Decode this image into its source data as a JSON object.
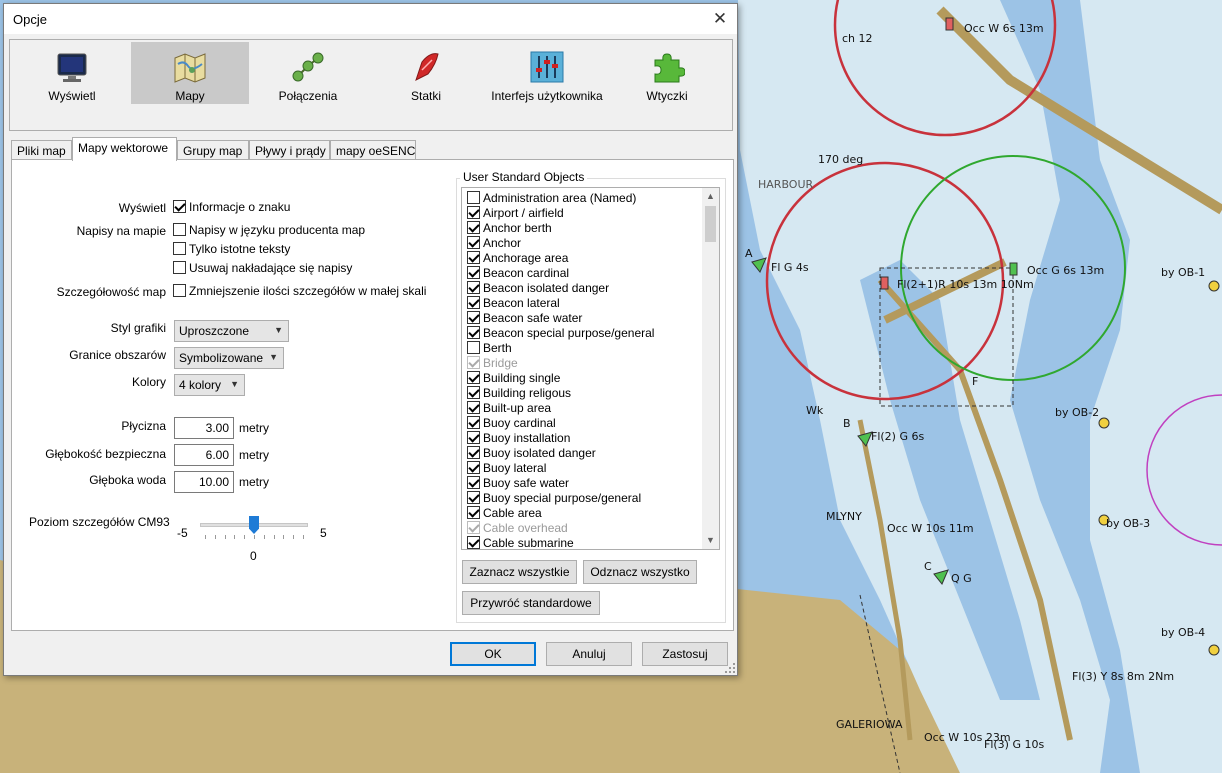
{
  "dialog": {
    "title": "Opcje",
    "close_glyph": "✕",
    "toolbar": [
      {
        "label": "Wyświetl",
        "icon": "monitor-icon"
      },
      {
        "label": "Mapy",
        "icon": "map-icon"
      },
      {
        "label": "Połączenia",
        "icon": "network-icon"
      },
      {
        "label": "Statki",
        "icon": "ship-icon"
      },
      {
        "label": "Interfejs użytkownika",
        "icon": "sliders-icon"
      },
      {
        "label": "Wtyczki",
        "icon": "puzzle-icon"
      }
    ],
    "active_toolbar": "Mapy",
    "tabs": [
      "Pliki map",
      "Mapy wektorowe",
      "Grupy map",
      "Pływy i prądy",
      "mapy oeSENC"
    ],
    "active_tab": "Mapy wektorowe",
    "left": {
      "display_label": "Wyświetl",
      "display_option": "Informacje o znaku",
      "text_label": "Napisy na mapie",
      "text_options": [
        "Napisy w języku producenta map",
        "Tylko istotne teksty",
        "Usuwaj nakładające się napisy"
      ],
      "detail_label": "Szczegółowość map",
      "detail_option": "Zmniejszenie ilości szczegółów w małej skali",
      "graphic_style_label": "Styl grafiki",
      "graphic_style_value": "Uproszczone",
      "boundaries_label": "Granice obszarów",
      "boundaries_value": "Symbolizowane",
      "colors_label": "Kolory",
      "colors_value": "4 kolory",
      "shallow_label": "Płycizna",
      "shallow_value": "3.00",
      "safety_label": "Głębokość bezpieczna",
      "safety_value": "6.00",
      "deep_label": "Głęboka woda",
      "deep_value": "10.00",
      "unit": "metry",
      "cm93_label": "Poziom szczegółów CM93",
      "cm93_min": "-5",
      "cm93_max": "5",
      "cm93_value": "0",
      "cm93_fraction": 0.5
    },
    "uso": {
      "title": "User Standard Objects",
      "items": [
        {
          "label": "Administration area (Named)",
          "checked": false,
          "disabled": false
        },
        {
          "label": "Airport / airfield",
          "checked": true,
          "disabled": false
        },
        {
          "label": "Anchor berth",
          "checked": true,
          "disabled": false
        },
        {
          "label": "Anchor",
          "checked": true,
          "disabled": false
        },
        {
          "label": "Anchorage area",
          "checked": true,
          "disabled": false
        },
        {
          "label": "Beacon cardinal",
          "checked": true,
          "disabled": false
        },
        {
          "label": "Beacon isolated danger",
          "checked": true,
          "disabled": false
        },
        {
          "label": "Beacon lateral",
          "checked": true,
          "disabled": false
        },
        {
          "label": "Beacon safe water",
          "checked": true,
          "disabled": false
        },
        {
          "label": "Beacon special purpose/general",
          "checked": true,
          "disabled": false
        },
        {
          "label": "Berth",
          "checked": false,
          "disabled": false
        },
        {
          "label": "Bridge",
          "checked": true,
          "disabled": true
        },
        {
          "label": "Building single",
          "checked": true,
          "disabled": false
        },
        {
          "label": "Building religous",
          "checked": true,
          "disabled": false
        },
        {
          "label": "Built-up area",
          "checked": true,
          "disabled": false
        },
        {
          "label": "Buoy cardinal",
          "checked": true,
          "disabled": false
        },
        {
          "label": "Buoy installation",
          "checked": true,
          "disabled": false
        },
        {
          "label": "Buoy isolated danger",
          "checked": true,
          "disabled": false
        },
        {
          "label": "Buoy lateral",
          "checked": true,
          "disabled": false
        },
        {
          "label": "Buoy safe water",
          "checked": true,
          "disabled": false
        },
        {
          "label": "Buoy special purpose/general",
          "checked": true,
          "disabled": false
        },
        {
          "label": "Cable area",
          "checked": true,
          "disabled": false
        },
        {
          "label": "Cable overhead",
          "checked": true,
          "disabled": true
        },
        {
          "label": "Cable submarine",
          "checked": true,
          "disabled": false
        }
      ],
      "select_all": "Zaznacz wszystkie",
      "deselect_all": "Odznacz wszystko",
      "restore_defaults": "Przywróć standardowe"
    },
    "buttons": {
      "ok": "OK",
      "cancel": "Anuluj",
      "apply": "Zastosuj"
    }
  },
  "chart_map": {
    "labels": [
      "ch 12",
      "Occ W 6s 13m",
      "170 deg",
      "HARBOUR",
      "Fl G 4s",
      "Fl(2+1)R 10s 13m 10Nm",
      "Occ G 6s 13m",
      "by OB-1",
      "by OB-2",
      "Fl(2) G 6s",
      "MLYNY",
      "Occ W 10s 11m",
      "by OB-3",
      "Q G",
      "by OB-4",
      "Fl(3) Y 8s 8m 2Nm",
      "GALERIOWA",
      "Occ W 10s 23m",
      "Fl(3) G 10s",
      "A",
      "B",
      "C",
      "F",
      "Wk"
    ],
    "colors": {
      "deep": "#9cc3e6",
      "shallow": "#d6e8f2",
      "land": "#c8b27a",
      "channel": "#b49a5c",
      "range_red": "#c8323c",
      "range_green": "#2fa82f",
      "range_magenta": "#c040c0"
    }
  }
}
